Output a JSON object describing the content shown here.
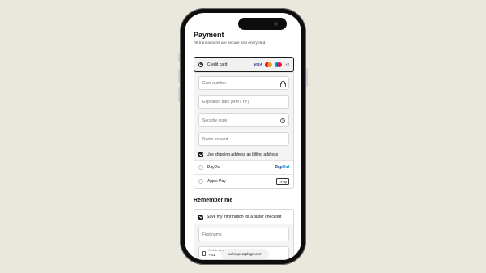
{
  "payment": {
    "title": "Payment",
    "subtitle": "All transactions are secure and encrypted.",
    "credit_card": {
      "label": "Credit card",
      "logos": [
        "VISA",
        "mastercard",
        "maestro"
      ],
      "more": "+2",
      "fields": {
        "card_number": "Card number",
        "expiration": "Expiration date (MM / YY)",
        "security_code": "Security code",
        "name_on_card": "Name on card"
      },
      "billing_checkbox": "Use shipping address as billing address",
      "billing_checked": true
    },
    "paypal": {
      "label": "PayPal",
      "logo_part1": "Pay",
      "logo_part2": "Pal"
    },
    "apple_pay": {
      "label": "Apple Pay",
      "badge": "Pay"
    }
  },
  "remember": {
    "title": "Remember me",
    "save_checkbox": "Save my information for a faster checkout",
    "save_checked": true,
    "first_name": "First name",
    "phone_label": "Mobile phone number",
    "phone_value": "+61"
  },
  "browser": {
    "url": "au.loopearplugs.com"
  },
  "colors": {
    "background": "#eae7dc",
    "frame": "#0d0d0d",
    "accent": "#1a1a1a"
  },
  "icons": [
    "lock-icon",
    "help-icon",
    "phone-icon"
  ]
}
